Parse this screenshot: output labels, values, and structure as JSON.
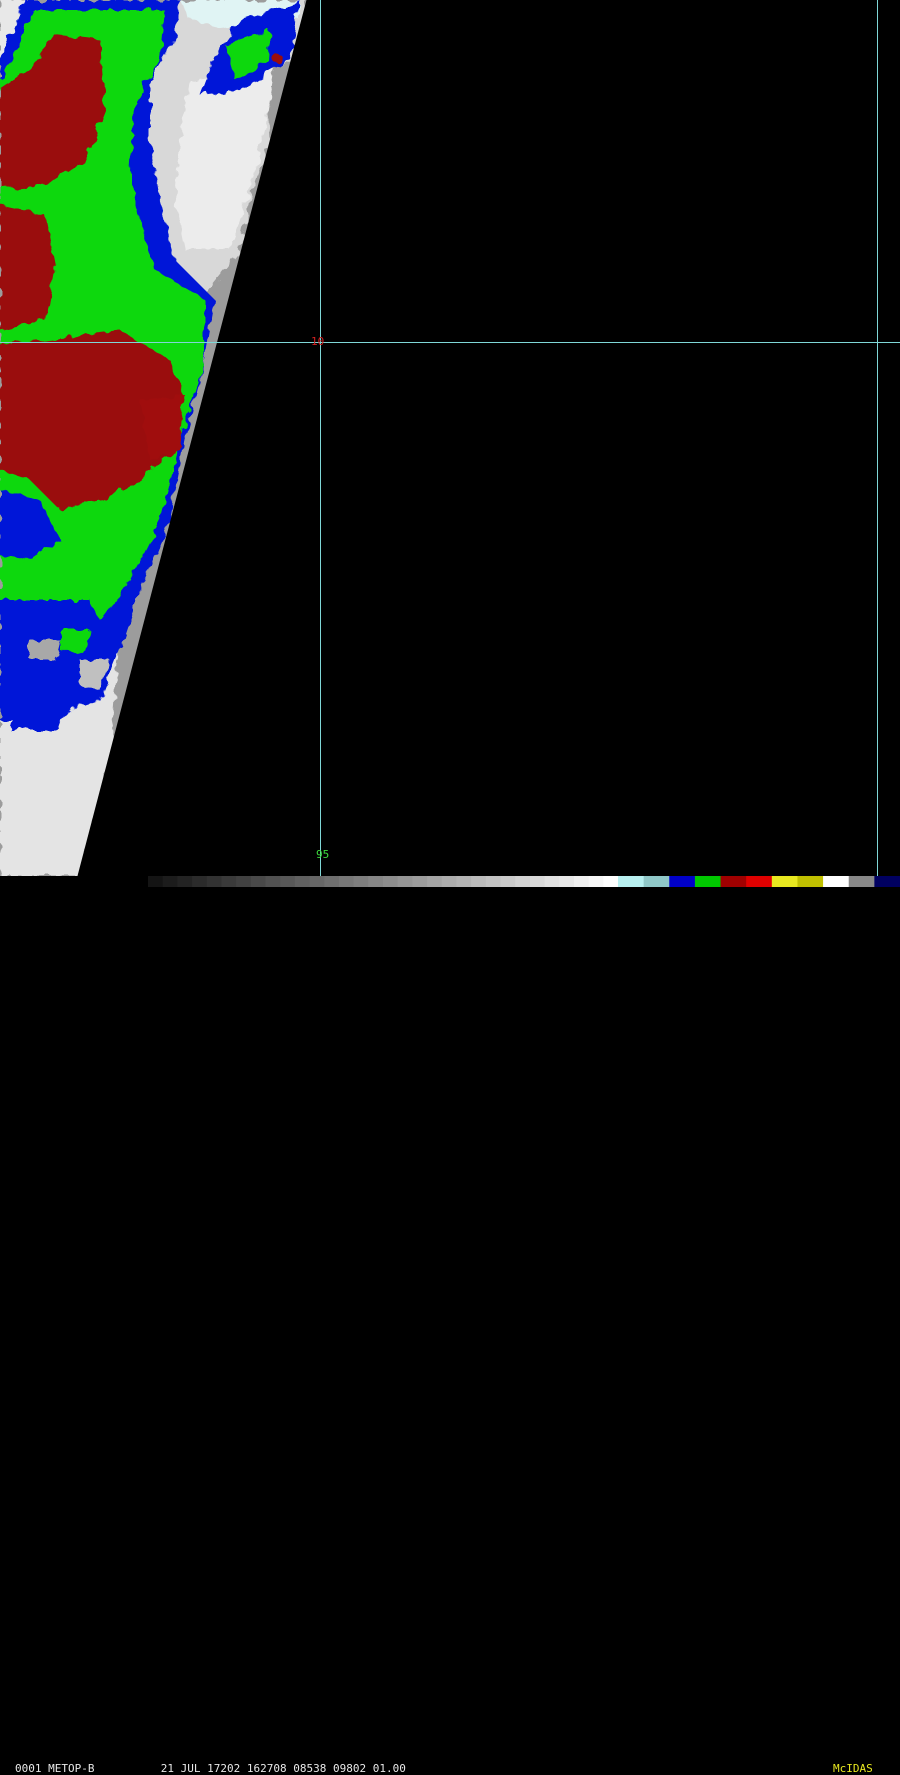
{
  "overlay": {
    "lat_label": "10",
    "lon_label": "95",
    "grid_color": "#7fd7d7",
    "lat_label_color": "#d42020",
    "lon_label_color": "#3ddc3d"
  },
  "status": {
    "frame": "0001",
    "satellite": "METOP-B",
    "day": "21",
    "month": "JUL",
    "julian_date": "17202",
    "time": "162708",
    "line": "08538",
    "element": "09802",
    "magnification": "01.00",
    "software": "McIDAS",
    "text_color": "#e8e8e8",
    "software_color": "#e8e820"
  },
  "enhancement": {
    "palette": [
      "#202020",
      "#404040",
      "#606060",
      "#808080",
      "#a0a0a0",
      "#c8c8c8",
      "#ffffff",
      "#b8f0f0",
      "#90c8c8",
      "#0000c8",
      "#00c800",
      "#a00000",
      "#e00000",
      "#e8e820",
      "#c0c000",
      "#ffffff",
      "#888888",
      "#000060"
    ],
    "cloud_colors": {
      "warm": "#a0a0a0",
      "cool": "#e0e0e0",
      "cold": "#0018d8",
      "colder": "#10d810",
      "coldest": "#9a0a0a"
    }
  }
}
